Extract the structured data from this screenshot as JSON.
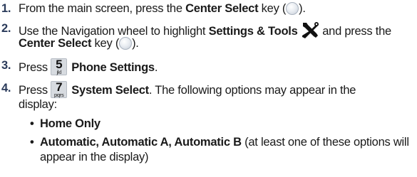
{
  "steps": [
    {
      "number": "1.",
      "pre": "From the main screen, press the ",
      "bold": "Center Select",
      "post_key": " key (",
      "post": ")."
    },
    {
      "number": "2.",
      "pre": "Use the Navigation wheel to highlight ",
      "bold": "Settings & Tools",
      "mid": " and press the",
      "bold2": "Center Select",
      "post_key": " key (",
      "post": ")."
    },
    {
      "number": "3.",
      "pre": "Press ",
      "key_digit": "5",
      "key_letters": "jkl",
      "bold": "Phone Settings",
      "post": "."
    },
    {
      "number": "4.",
      "pre": "Press ",
      "key_digit": "7",
      "key_letters": "pqrs",
      "bold": "System Select",
      "post": ". The following options may appear in the",
      "line2": "display:"
    }
  ],
  "bullets": [
    {
      "bold": "Home Only",
      "rest": ""
    },
    {
      "bold": "Automatic, Automatic A, Automatic B",
      "rest": " (at least one of these options will",
      "line2": "appear in the display)"
    }
  ],
  "icons": {
    "center_select_key": "center-select-key-icon",
    "settings_tools": "settings-tools-icon"
  },
  "colors": {
    "step_number": "#2a3a5a",
    "text": "#1a1a1a",
    "key_face": "#d7dbe0"
  }
}
